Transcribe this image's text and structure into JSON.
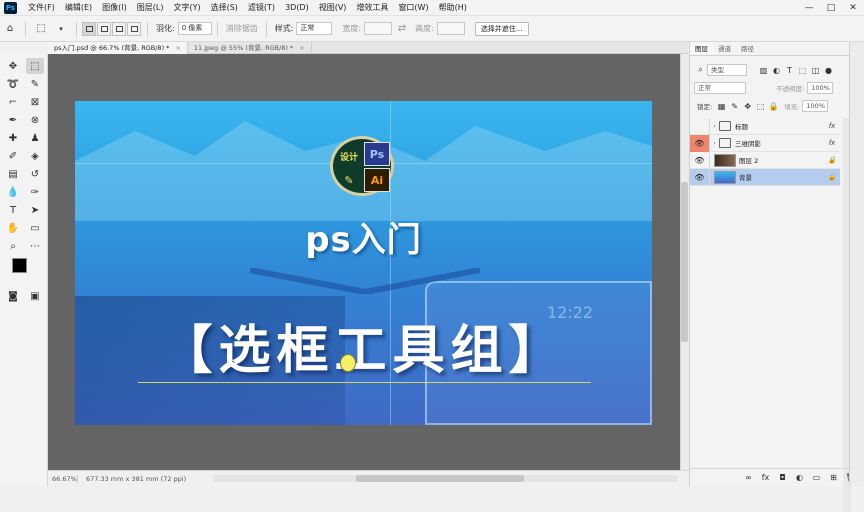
{
  "app": {
    "logo": "Ps"
  },
  "menubar": {
    "items": [
      "文件(F)",
      "编辑(E)",
      "图像(I)",
      "图层(L)",
      "文字(Y)",
      "选择(S)",
      "滤镜(T)",
      "3D(D)",
      "视图(V)",
      "增效工具",
      "窗口(W)",
      "帮助(H)"
    ],
    "controls": [
      "—",
      "□",
      "✕"
    ]
  },
  "options": {
    "feather_label": "羽化:",
    "feather_value": "0 像素",
    "antialias_label": "消除锯齿",
    "style_label": "样式:",
    "style_value": "正常",
    "width_label": "宽度:",
    "height_label": "高度:",
    "select_mask_button": "选择并遮住..."
  },
  "doctabs": [
    {
      "label": "ps入门.psd @ 66.7% (背景, RGB/8) *",
      "close": "×"
    },
    {
      "label": "11.jpeg @ 55% (背景, RGB/8) *",
      "close": "×"
    }
  ],
  "artboard": {
    "subtitle": "ps入门",
    "title": "【选框工具组】",
    "logo": {
      "q1": "设计",
      "q2": "Ps",
      "q3": "",
      "q4": "Ai"
    },
    "clock_text": "12:22"
  },
  "status": {
    "zoom": "66.67%",
    "info": "677.33 mm x 381 mm (72 ppi)"
  },
  "panels": {
    "tabs": [
      "图层",
      "通道",
      "路径"
    ],
    "kind_label": "类型",
    "blend_mode": "正常",
    "opacity_label": "不透明度:",
    "opacity_value": "100%",
    "lock_label": "锁定:",
    "fill_label": "填充:",
    "fill_value": "100%",
    "layers": [
      {
        "name": "标题",
        "type": "folder",
        "visible": false,
        "right": "fx"
      },
      {
        "name": "三维阴影",
        "type": "folder",
        "visible": true,
        "highlight": true,
        "right": "fx"
      },
      {
        "name": "图层 2",
        "type": "image",
        "visible": true,
        "right": "🔒"
      },
      {
        "name": "背景",
        "type": "image",
        "visible": true,
        "selected": true,
        "right": "🔒"
      }
    ],
    "bottom_icons": [
      "link-icon",
      "fx-icon",
      "mask-icon",
      "adjustment-icon",
      "group-icon",
      "new-layer-icon",
      "trash-icon"
    ]
  },
  "colors": {
    "accent_selected_layer": "#b4cdee",
    "eye_highlight": "#f0856e",
    "art_top": "#3ab6ef",
    "art_bottom": "#4169c5"
  }
}
